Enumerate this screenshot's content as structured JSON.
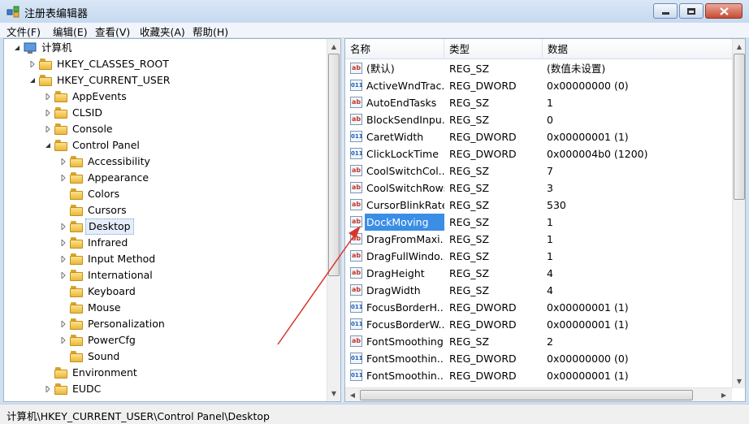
{
  "window": {
    "title": "注册表编辑器"
  },
  "menu": [
    "文件(F)",
    "编辑(E)",
    "查看(V)",
    "收藏夹(A)",
    "帮助(H)"
  ],
  "tree": [
    {
      "label": "计算机",
      "depth": 0,
      "exp": "open",
      "icon": "computer"
    },
    {
      "label": "HKEY_CLASSES_ROOT",
      "depth": 1,
      "exp": "closed"
    },
    {
      "label": "HKEY_CURRENT_USER",
      "depth": 1,
      "exp": "open"
    },
    {
      "label": "AppEvents",
      "depth": 2,
      "exp": "closed"
    },
    {
      "label": "CLSID",
      "depth": 2,
      "exp": "closed"
    },
    {
      "label": "Console",
      "depth": 2,
      "exp": "closed"
    },
    {
      "label": "Control Panel",
      "depth": 2,
      "exp": "open"
    },
    {
      "label": "Accessibility",
      "depth": 3,
      "exp": "closed"
    },
    {
      "label": "Appearance",
      "depth": 3,
      "exp": "closed"
    },
    {
      "label": "Colors",
      "depth": 3,
      "exp": "none"
    },
    {
      "label": "Cursors",
      "depth": 3,
      "exp": "none"
    },
    {
      "label": "Desktop",
      "depth": 3,
      "exp": "closed",
      "selected": true
    },
    {
      "label": "Infrared",
      "depth": 3,
      "exp": "closed"
    },
    {
      "label": "Input Method",
      "depth": 3,
      "exp": "closed"
    },
    {
      "label": "International",
      "depth": 3,
      "exp": "closed"
    },
    {
      "label": "Keyboard",
      "depth": 3,
      "exp": "none"
    },
    {
      "label": "Mouse",
      "depth": 3,
      "exp": "none"
    },
    {
      "label": "Personalization",
      "depth": 3,
      "exp": "closed"
    },
    {
      "label": "PowerCfg",
      "depth": 3,
      "exp": "closed"
    },
    {
      "label": "Sound",
      "depth": 3,
      "exp": "none"
    },
    {
      "label": "Environment",
      "depth": 2,
      "exp": "none"
    },
    {
      "label": "EUDC",
      "depth": 2,
      "exp": "closed"
    }
  ],
  "columns": {
    "name": "名称",
    "type": "类型",
    "data": "数据"
  },
  "values": [
    {
      "name": "(默认)",
      "type": "REG_SZ",
      "data": "(数值未设置)",
      "kind": "sz"
    },
    {
      "name": "ActiveWndTrac...",
      "type": "REG_DWORD",
      "data": "0x00000000 (0)",
      "kind": "dword"
    },
    {
      "name": "AutoEndTasks",
      "type": "REG_SZ",
      "data": "1",
      "kind": "sz"
    },
    {
      "name": "BlockSendInpu...",
      "type": "REG_SZ",
      "data": "0",
      "kind": "sz"
    },
    {
      "name": "CaretWidth",
      "type": "REG_DWORD",
      "data": "0x00000001 (1)",
      "kind": "dword"
    },
    {
      "name": "ClickLockTime",
      "type": "REG_DWORD",
      "data": "0x000004b0 (1200)",
      "kind": "dword"
    },
    {
      "name": "CoolSwitchCol...",
      "type": "REG_SZ",
      "data": "7",
      "kind": "sz"
    },
    {
      "name": "CoolSwitchRows",
      "type": "REG_SZ",
      "data": "3",
      "kind": "sz"
    },
    {
      "name": "CursorBlinkRate",
      "type": "REG_SZ",
      "data": "530",
      "kind": "sz"
    },
    {
      "name": "DockMoving",
      "type": "REG_SZ",
      "data": "1",
      "kind": "sz",
      "selected": true
    },
    {
      "name": "DragFromMaxi...",
      "type": "REG_SZ",
      "data": "1",
      "kind": "sz"
    },
    {
      "name": "DragFullWindo...",
      "type": "REG_SZ",
      "data": "1",
      "kind": "sz"
    },
    {
      "name": "DragHeight",
      "type": "REG_SZ",
      "data": "4",
      "kind": "sz"
    },
    {
      "name": "DragWidth",
      "type": "REG_SZ",
      "data": "4",
      "kind": "sz"
    },
    {
      "name": "FocusBorderH...",
      "type": "REG_DWORD",
      "data": "0x00000001 (1)",
      "kind": "dword"
    },
    {
      "name": "FocusBorderW...",
      "type": "REG_DWORD",
      "data": "0x00000001 (1)",
      "kind": "dword"
    },
    {
      "name": "FontSmoothing",
      "type": "REG_SZ",
      "data": "2",
      "kind": "sz"
    },
    {
      "name": "FontSmoothin...",
      "type": "REG_DWORD",
      "data": "0x00000000 (0)",
      "kind": "dword"
    },
    {
      "name": "FontSmoothin...",
      "type": "REG_DWORD",
      "data": "0x00000001 (1)",
      "kind": "dword"
    }
  ],
  "status": "计算机\\HKEY_CURRENT_USER\\Control Panel\\Desktop",
  "colors": {
    "selection": "#3a8ee6",
    "arrow": "#d9342b"
  }
}
